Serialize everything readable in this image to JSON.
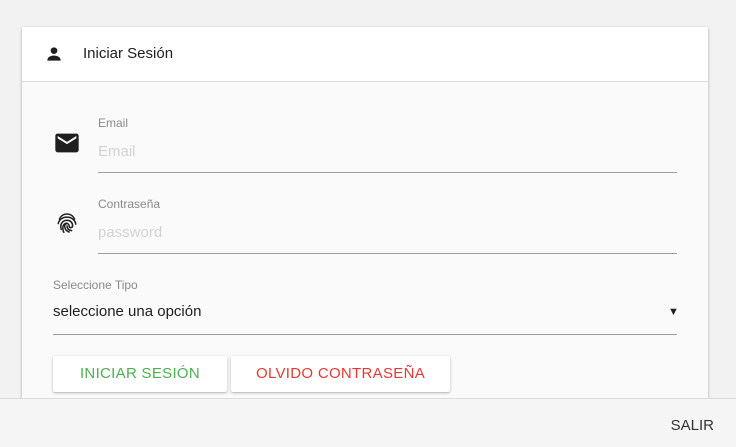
{
  "login_card": {
    "title": "Iniciar Sesión",
    "header_icon": "person-icon",
    "email": {
      "icon": "envelope-icon",
      "label": "Email",
      "placeholder": "Email",
      "value": ""
    },
    "password": {
      "icon": "fingerprint-icon",
      "label": "Contraseña",
      "placeholder": "password",
      "value": ""
    },
    "type_select": {
      "label": "Seleccione Tipo",
      "selected": "seleccione una opción",
      "caret": "▼"
    },
    "buttons": {
      "login_label": "INICIAR SESIÓN",
      "forgot_label": "OLVIDO CONTRASEÑA"
    }
  },
  "footer": {
    "exit_label": "SALIR"
  },
  "colors": {
    "login_green": "#4caf50",
    "forgot_red": "#e53935",
    "underline": "#9e9e9e",
    "label_gray": "#8a8a8a"
  }
}
